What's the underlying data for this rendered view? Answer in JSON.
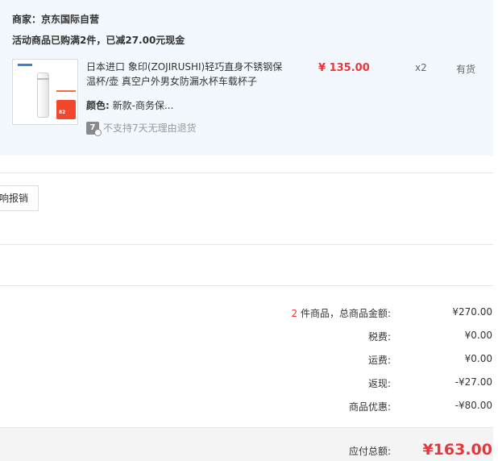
{
  "shop": {
    "merchant": "商家：京东国际自营",
    "promotion": "活动商品已购满2件，已减27.00元现金"
  },
  "product": {
    "name": "日本进口 象印(ZOJIRUSHI)轻巧直身不锈钢保温杯/壶 真空户外男女防漏水杯车载杯子",
    "color_label": "颜色:",
    "color_value": "新款-商务保...",
    "return_icon": "7",
    "return_policy": "不支持7天无理由退货",
    "price": "¥ 135.00",
    "quantity": "x2",
    "stock": "有货",
    "thumbnail_tag": "82"
  },
  "invoice": {
    "button_label": "响报销"
  },
  "summary": {
    "item_count": "2",
    "goods_label": "件商品，总商品金额:",
    "goods_value": "¥270.00",
    "tax_label": "税费:",
    "tax_value": "¥0.00",
    "shipping_label": "运费:",
    "shipping_value": "¥0.00",
    "cashback_label": "返现:",
    "cashback_value": "-¥27.00",
    "discount_label": "商品优惠:",
    "discount_value": "-¥80.00",
    "total_label": "应付总额:",
    "total_value": "¥163.00"
  },
  "colors": {
    "accent_red": "#e4393c",
    "shop_bg": "#f2f8fd"
  }
}
